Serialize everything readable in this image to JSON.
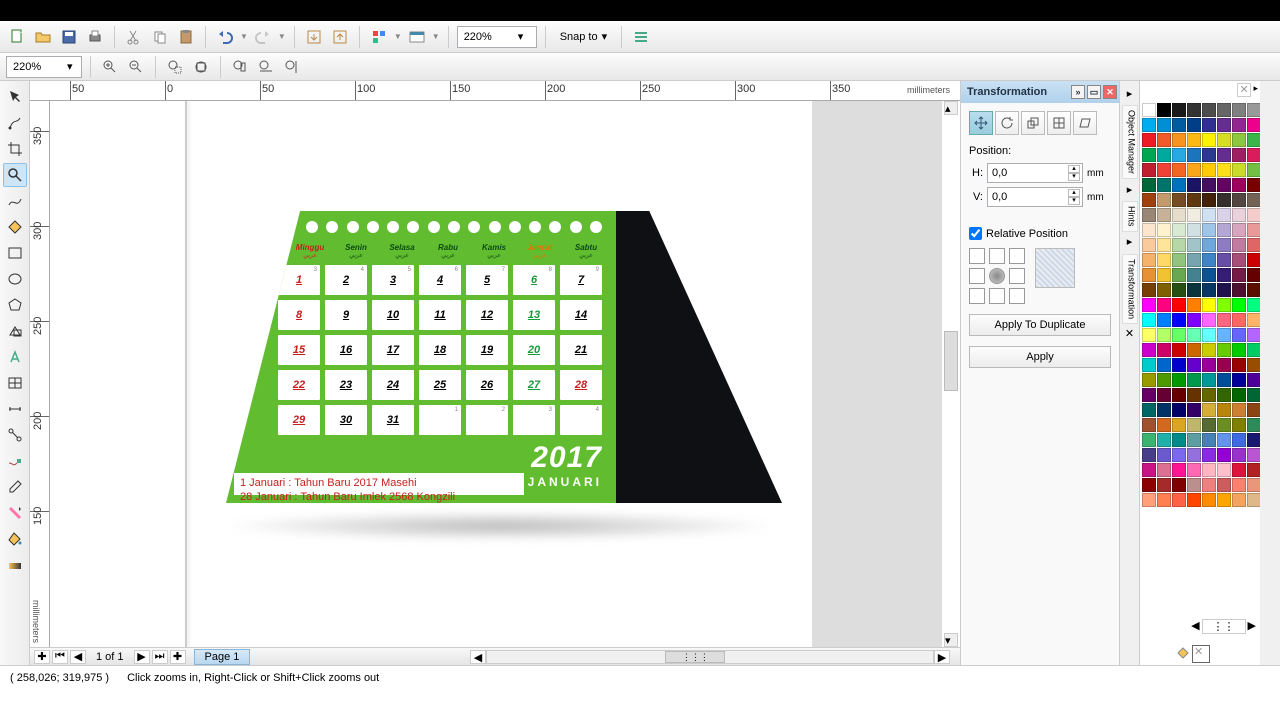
{
  "toolbar": {
    "zoom_main": "220%",
    "snap_label": "Snap to",
    "zoom2": "220%"
  },
  "rulers": {
    "h": [
      "50",
      "0",
      "50",
      "100",
      "150",
      "200",
      "250",
      "300",
      "350"
    ],
    "h_unit": "millimeters",
    "v": [
      "350",
      "300",
      "250",
      "200",
      "150"
    ],
    "v_unit": "millimeters"
  },
  "calendar": {
    "days": [
      {
        "name": "Minggu",
        "cls": "sun"
      },
      {
        "name": "Senin",
        "cls": ""
      },
      {
        "name": "Selasa",
        "cls": ""
      },
      {
        "name": "Rabu",
        "cls": ""
      },
      {
        "name": "Kamis",
        "cls": ""
      },
      {
        "name": "Jum'at",
        "cls": "fri"
      },
      {
        "name": "Sabtu",
        "cls": ""
      }
    ],
    "cells": [
      {
        "n": "1",
        "cls": "red",
        "s": "3"
      },
      {
        "n": "2",
        "cls": "",
        "s": "4"
      },
      {
        "n": "3",
        "cls": "",
        "s": "5"
      },
      {
        "n": "4",
        "cls": "",
        "s": "6"
      },
      {
        "n": "5",
        "cls": "",
        "s": "7"
      },
      {
        "n": "6",
        "cls": "green",
        "s": "8"
      },
      {
        "n": "7",
        "cls": "",
        "s": "9"
      },
      {
        "n": "8",
        "cls": "red",
        "s": ""
      },
      {
        "n": "9",
        "cls": "",
        "s": ""
      },
      {
        "n": "10",
        "cls": "",
        "s": ""
      },
      {
        "n": "11",
        "cls": "",
        "s": ""
      },
      {
        "n": "12",
        "cls": "",
        "s": ""
      },
      {
        "n": "13",
        "cls": "green",
        "s": ""
      },
      {
        "n": "14",
        "cls": "",
        "s": ""
      },
      {
        "n": "15",
        "cls": "red",
        "s": ""
      },
      {
        "n": "16",
        "cls": "",
        "s": ""
      },
      {
        "n": "17",
        "cls": "",
        "s": ""
      },
      {
        "n": "18",
        "cls": "",
        "s": ""
      },
      {
        "n": "19",
        "cls": "",
        "s": ""
      },
      {
        "n": "20",
        "cls": "green",
        "s": ""
      },
      {
        "n": "21",
        "cls": "",
        "s": ""
      },
      {
        "n": "22",
        "cls": "red",
        "s": ""
      },
      {
        "n": "23",
        "cls": "",
        "s": ""
      },
      {
        "n": "24",
        "cls": "",
        "s": ""
      },
      {
        "n": "25",
        "cls": "",
        "s": ""
      },
      {
        "n": "26",
        "cls": "",
        "s": ""
      },
      {
        "n": "27",
        "cls": "green",
        "s": ""
      },
      {
        "n": "28",
        "cls": "red",
        "s": ""
      },
      {
        "n": "29",
        "cls": "red",
        "s": ""
      },
      {
        "n": "30",
        "cls": "",
        "s": ""
      },
      {
        "n": "31",
        "cls": "",
        "s": ""
      },
      {
        "n": "",
        "cls": "empty",
        "s": "1"
      },
      {
        "n": "",
        "cls": "empty",
        "s": "2"
      },
      {
        "n": "",
        "cls": "empty",
        "s": "3"
      },
      {
        "n": "",
        "cls": "empty",
        "s": "4"
      }
    ],
    "year": "2017",
    "month": "JANUARI",
    "note1": "1 Januari  :  Tahun Baru 2017 Masehi",
    "note2": "28 Januari :  Tahun Baru Imlek 2568 Kongzili"
  },
  "page_nav": {
    "label": "1 of 1",
    "tab": "Page 1"
  },
  "transformation": {
    "title": "Transformation",
    "position_label": "Position:",
    "h_label": "H:",
    "h_val": "0,0",
    "v_label": "V:",
    "v_val": "0,0",
    "unit": "mm",
    "relative": "Relative Position",
    "apply_dup": "Apply To Duplicate",
    "apply": "Apply"
  },
  "side_tabs": [
    "Object Manager",
    "Hints",
    "Transformation"
  ],
  "status": {
    "coords": "( 258,026; 319,975 )",
    "hint": "Click zooms in, Right-Click or Shift+Click zooms out"
  },
  "palette_colors": [
    "#ffffff",
    "#000000",
    "#1a1a1a",
    "#333333",
    "#4d4d4d",
    "#666666",
    "#808080",
    "#999999",
    "#00aeef",
    "#008fd5",
    "#005b9f",
    "#003f87",
    "#2e3192",
    "#662d91",
    "#92278f",
    "#ec008c",
    "#ed1c24",
    "#f15a29",
    "#f7941d",
    "#fdb913",
    "#fff200",
    "#d7df23",
    "#8dc63f",
    "#39b54a",
    "#00a651",
    "#00a99d",
    "#27aae1",
    "#1c75bc",
    "#2b3990",
    "#652d90",
    "#9e1f63",
    "#da1c5c",
    "#be1e2d",
    "#ef4136",
    "#f26522",
    "#faa61a",
    "#ffcb05",
    "#ffde17",
    "#cbdb2a",
    "#72bf44",
    "#006838",
    "#00736a",
    "#0071bc",
    "#1b1464",
    "#440e62",
    "#630460",
    "#9e005d",
    "#790000",
    "#a0410d",
    "#c49a6c",
    "#754c24",
    "#603913",
    "#42210b",
    "#362f2d",
    "#534741",
    "#736357",
    "#998675",
    "#c7b299",
    "#e6ddca",
    "#f1ece0",
    "#cfe2f3",
    "#d9d2e9",
    "#ead1dc",
    "#f4cccc",
    "#fce5cd",
    "#fff2cc",
    "#d9ead3",
    "#d0e0e3",
    "#9fc5e8",
    "#b4a7d6",
    "#d5a6bd",
    "#ea9999",
    "#f9cb9c",
    "#ffe599",
    "#b6d7a8",
    "#a2c4c9",
    "#6fa8dc",
    "#8e7cc3",
    "#c27ba0",
    "#e06666",
    "#f6b26b",
    "#ffd966",
    "#93c47d",
    "#76a5af",
    "#3d85c6",
    "#674ea7",
    "#a64d79",
    "#cc0000",
    "#e69138",
    "#f1c232",
    "#6aa84f",
    "#45818e",
    "#0b5394",
    "#351c75",
    "#741b47",
    "#660000",
    "#783f04",
    "#7f6000",
    "#274e13",
    "#0c343d",
    "#073763",
    "#20124d",
    "#4c1130",
    "#5b0f00",
    "#ff00ff",
    "#ff0080",
    "#ff0000",
    "#ff8000",
    "#ffff00",
    "#80ff00",
    "#00ff00",
    "#00ff80",
    "#00ffff",
    "#0080ff",
    "#0000ff",
    "#8000ff",
    "#ff66ff",
    "#ff6680",
    "#ff6666",
    "#ffb366",
    "#ffff66",
    "#b3ff66",
    "#66ff66",
    "#66ffb3",
    "#66ffff",
    "#66b3ff",
    "#6666ff",
    "#b366ff",
    "#cc00cc",
    "#cc0066",
    "#cc0000",
    "#cc6600",
    "#cccc00",
    "#66cc00",
    "#00cc00",
    "#00cc66",
    "#00cccc",
    "#0066cc",
    "#0000cc",
    "#6600cc",
    "#990099",
    "#99004d",
    "#990000",
    "#994d00",
    "#999900",
    "#4d9900",
    "#009900",
    "#00994d",
    "#009999",
    "#004d99",
    "#000099",
    "#4d0099",
    "#660066",
    "#660033",
    "#660000",
    "#663300",
    "#666600",
    "#336600",
    "#006600",
    "#006633",
    "#006666",
    "#003366",
    "#000066",
    "#330066",
    "#d4af37",
    "#b8860b",
    "#cd7f32",
    "#8b4513",
    "#a0522d",
    "#d2691e",
    "#daa520",
    "#bdb76b",
    "#556b2f",
    "#6b8e23",
    "#808000",
    "#2e8b57",
    "#3cb371",
    "#20b2aa",
    "#008b8b",
    "#5f9ea0",
    "#4682b4",
    "#6495ed",
    "#4169e1",
    "#191970",
    "#483d8b",
    "#6a5acd",
    "#7b68ee",
    "#9370db",
    "#8a2be2",
    "#9400d3",
    "#9932cc",
    "#ba55d3",
    "#c71585",
    "#db7093",
    "#ff1493",
    "#ff69b4",
    "#ffb6c1",
    "#ffc0cb",
    "#dc143c",
    "#b22222",
    "#8b0000",
    "#a52a2a",
    "#800000",
    "#bc8f8f",
    "#f08080",
    "#cd5c5c",
    "#fa8072",
    "#e9967a",
    "#ffa07a",
    "#ff7f50",
    "#ff6347",
    "#ff4500",
    "#ff8c00",
    "#ffa500",
    "#f4a460",
    "#deb887"
  ]
}
